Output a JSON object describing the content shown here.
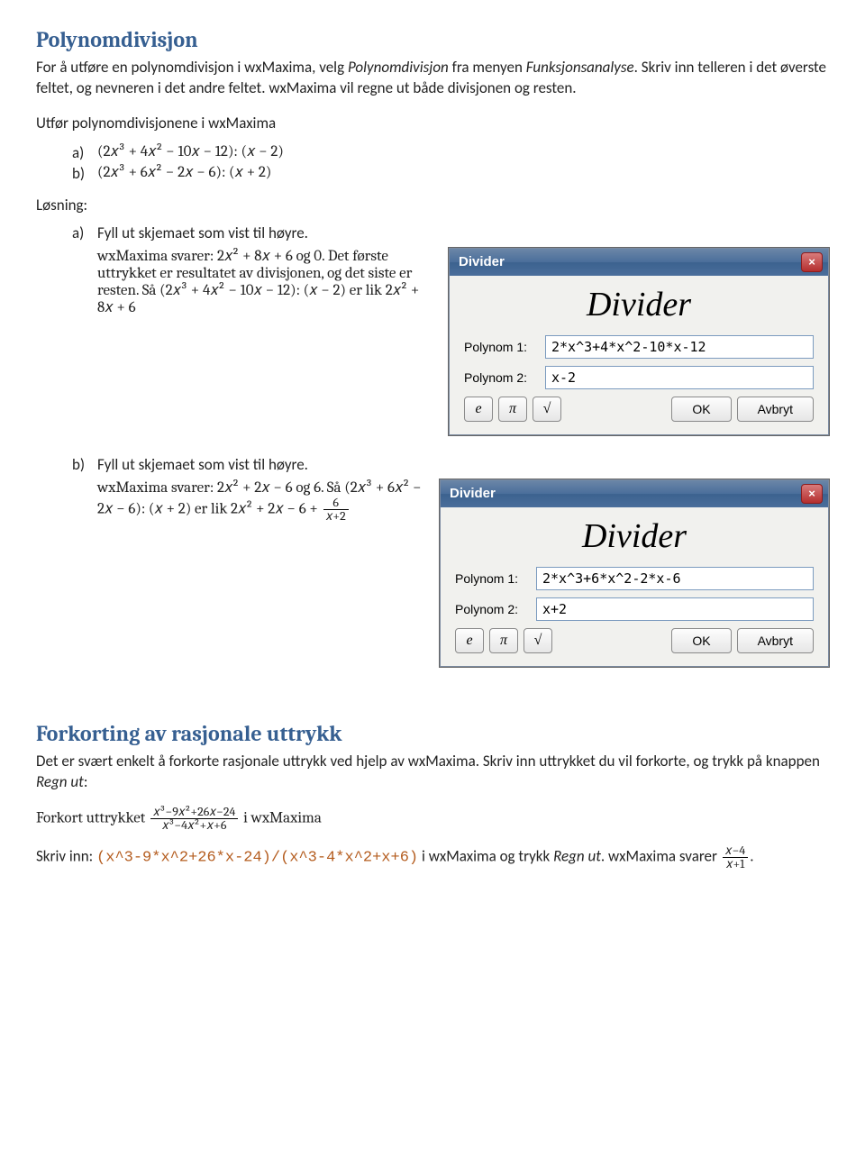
{
  "sec1": {
    "title": "Polynomdivisjon",
    "p1a": "For å utføre en polynomdivisjon i wxMaxima, velg ",
    "p1b": "Polynomdivisjon",
    "p1c": " fra menyen ",
    "p1d": "Funksjonsanalyse",
    "p1e": ". Skriv inn telleren i det øverste feltet, og nevneren i det andre feltet. wxMaxima vil regne ut både divisjonen og resten.",
    "p2": "Utfør polynomdivisjonene i wxMaxima",
    "items": {
      "a_marker": "a)",
      "a_math": "(2𝑥³ + 4𝑥² − 10𝑥 − 12): (𝑥 − 2)",
      "b_marker": "b)",
      "b_math": "(2𝑥³ + 6𝑥² − 2𝑥 − 6): (𝑥 + 2)"
    },
    "losning": "Løsning:",
    "a": {
      "marker": "a)",
      "lead": "Fyll ut skjemaet som vist til høyre.",
      "p1": "wxMaxima svarer:  2𝑥² + 8𝑥 + 6 og 0. Det første uttrykket er resultatet av divisjonen, og det siste er resten. Så (2𝑥³ + 4𝑥² − 10𝑥 − 12): (𝑥 − 2) er lik 2𝑥² + 8𝑥 + 6"
    },
    "b": {
      "marker": "b)",
      "lead": "Fyll ut skjemaet som vist til høyre.",
      "p1": "wxMaxima svarer: 2𝑥² + 2𝑥 − 6 og 6. Så (2𝑥³ + 6𝑥² − 2𝑥 − 6): (𝑥 + 2) er lik 2𝑥² + 2𝑥 − 6 + ",
      "frac_num": "6",
      "frac_den": "𝑥+2"
    }
  },
  "dialogs": {
    "title": "Divider",
    "heading": "Divider",
    "label_p1": "Polynom 1:",
    "label_p2": "Polynom 2:",
    "a": {
      "p1": "2*x^3+4*x^2-10*x-12",
      "p2": "x-2"
    },
    "b": {
      "p1": "2*x^3+6*x^2-2*x-6",
      "p2": "x+2"
    },
    "btn_e": "e",
    "btn_pi": "π",
    "btn_sqrt": "√",
    "btn_ok": "OK",
    "btn_cancel": "Avbryt",
    "close": "×"
  },
  "sec2": {
    "title": "Forkorting av rasjonale uttrykk",
    "p1a": "Det er svært enkelt å forkorte rasjonale uttrykk ved hjelp av wxMaxima. Skriv inn uttrykket du vil forkorte, og trykk på knappen ",
    "p1b": "Regn ut",
    "p1c": ":",
    "p2a": "Forkort uttrykket ",
    "frac1_num": "𝑥³−9𝑥²+26𝑥−24",
    "frac1_den": "𝑥³−4𝑥²+𝑥+6",
    "p2b": " i wxMaxima",
    "p3a": "Skriv inn: ",
    "code": "(x^3-9*x^2+26*x-24)/(x^3-4*x^2+x+6)",
    "p3b": "   i wxMaxima og trykk ",
    "p3c": "Regn ut",
    "p3d": ". wxMaxima svarer ",
    "frac2_num": "𝑥−4",
    "frac2_den": "𝑥+1",
    "p3e": "."
  }
}
